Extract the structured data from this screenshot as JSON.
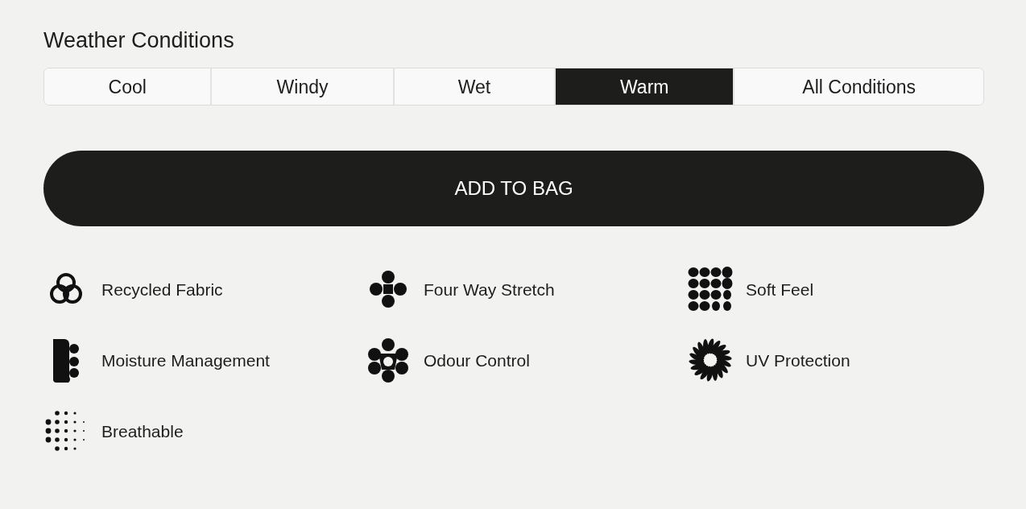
{
  "section_title": "Weather Conditions",
  "conditions": [
    {
      "label": "Cool",
      "selected": false
    },
    {
      "label": "Windy",
      "selected": false
    },
    {
      "label": "Wet",
      "selected": false
    },
    {
      "label": "Warm",
      "selected": true
    },
    {
      "label": "All Conditions",
      "selected": false
    }
  ],
  "add_button": "ADD TO BAG",
  "features": [
    {
      "label": "Recycled Fabric",
      "kind": "recycle"
    },
    {
      "label": "Four Way Stretch",
      "kind": "clover"
    },
    {
      "label": "Soft Feel",
      "kind": "pebbles"
    },
    {
      "label": "Moisture Management",
      "kind": "drip"
    },
    {
      "label": "Odour Control",
      "kind": "trefoil"
    },
    {
      "label": "UV Protection",
      "kind": "sunburst"
    },
    {
      "label": "Breathable",
      "kind": "dots"
    }
  ]
}
